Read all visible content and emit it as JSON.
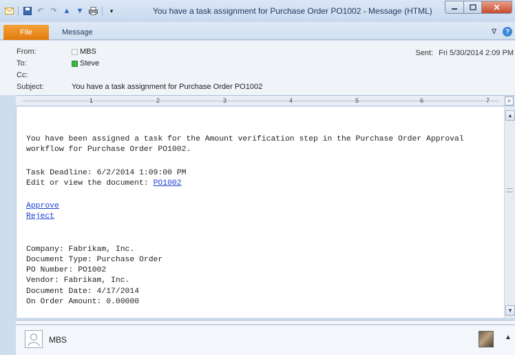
{
  "window": {
    "title": "You have a task assignment for Purchase Order PO1002  -  Message (HTML)"
  },
  "ribbon": {
    "file_tab": "File",
    "message_tab": "Message",
    "help_glyph": "?"
  },
  "header": {
    "from_label": "From:",
    "from_value": "MBS",
    "to_label": "To:",
    "to_value": "Steve",
    "cc_label": "Cc:",
    "subject_label": "Subject:",
    "subject_value": "You have a task assignment for Purchase Order PO1002",
    "sent_label": "Sent:",
    "sent_value": "Fri 5/30/2014 2:09 PM"
  },
  "ruler": {
    "numbers": [
      "1",
      "2",
      "3",
      "4",
      "5",
      "6",
      "7"
    ]
  },
  "body": {
    "intro_line1": "You have been assigned a task for the Amount verification step in the Purchase Order Approval",
    "intro_line2": "workflow for Purchase Order PO1002.",
    "deadline": "Task Deadline: 6/2/2014 1:09:00 PM",
    "edit_prefix": "Edit or view the document: ",
    "edit_link": "PO1002",
    "approve_link": "Approve",
    "reject_link": "Reject",
    "company": "Company: Fabrikam, Inc.",
    "doc_type": "Document Type: Purchase Order",
    "po_number": "PO Number: PO1002",
    "vendor": "Vendor: Fabrikam, Inc.",
    "doc_date": "Document Date: 4/17/2014",
    "amount": "On Order Amount: 0.00000"
  },
  "people_pane": {
    "name": "MBS"
  },
  "colors": {
    "file_tab": "#e8830f",
    "link": "#1a3fd1",
    "presence_online": "#39b54a",
    "close_button": "#c84b2d"
  }
}
